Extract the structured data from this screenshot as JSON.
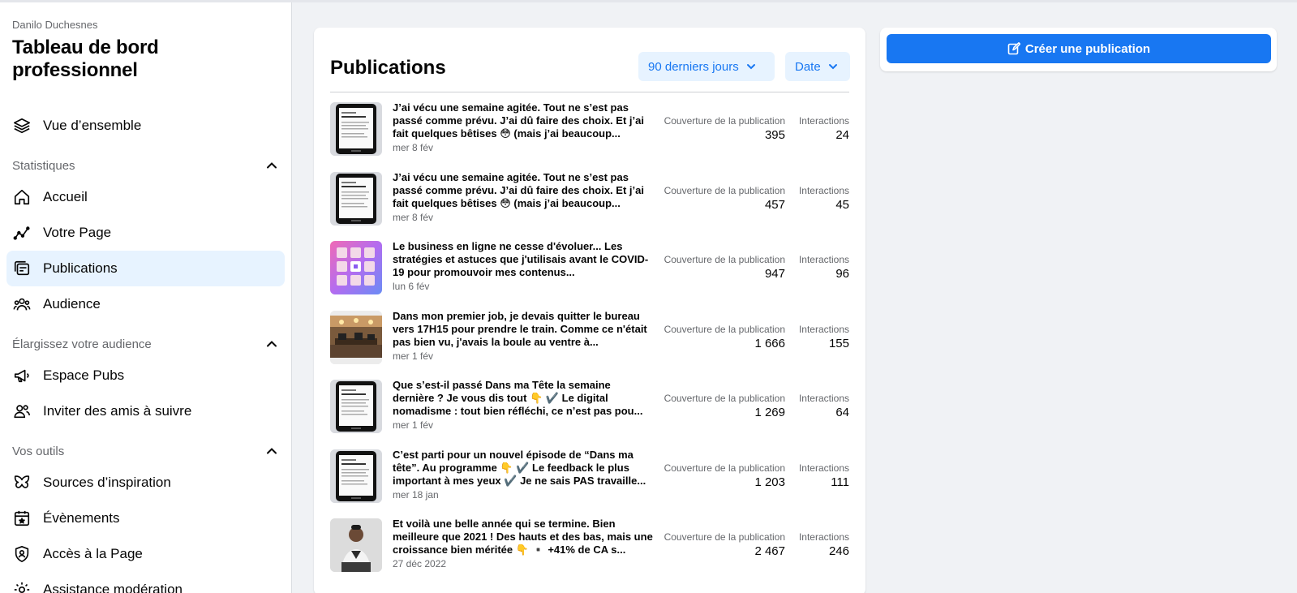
{
  "sidebar": {
    "owner": "Danilo Duchesnes",
    "title": "Tableau de bord professionnel",
    "overview": "Vue d’ensemble",
    "sections": [
      {
        "label": "Statistiques",
        "items": [
          "Accueil",
          "Votre Page",
          "Publications",
          "Audience"
        ]
      },
      {
        "label": "Élargissez votre audience",
        "items": [
          "Espace Pubs",
          "Inviter des amis à suivre"
        ]
      },
      {
        "label": "Vos outils",
        "items": [
          "Sources d’inspiration",
          "Évènements",
          "Accès à la Page",
          "Assistance modération"
        ]
      }
    ],
    "active_item": "Publications"
  },
  "card": {
    "title": "Publications",
    "range_filter": "90 derniers jours",
    "sort_filter": "Date",
    "reach_label": "Couverture de la publication",
    "interactions_label": "Interactions"
  },
  "posts": [
    {
      "text": "J’ai vécu une semaine agitée. Tout ne s’est pas passé comme prévu. J’ai dû faire des choix. Et j’ai fait quelques bêtises 😳 (mais j’ai beaucoup...",
      "date": "mer 8 fév",
      "reach": "395",
      "interactions": "24",
      "thumb": "phone-dark"
    },
    {
      "text": "J’ai vécu une semaine agitée. Tout ne s’est pas passé comme prévu. J’ai dû faire des choix. Et j’ai fait quelques bêtises 😳 (mais j’ai beaucoup...",
      "date": "mer 8 fév",
      "reach": "457",
      "interactions": "45",
      "thumb": "phone-dark"
    },
    {
      "text": "Le business en ligne ne cesse d'évoluer... Les stratégies et astuces que j'utilisais avant le COVID-19 pour promouvoir mes contenus...",
      "date": "lun 6 fév",
      "reach": "947",
      "interactions": "96",
      "thumb": "grid-pink"
    },
    {
      "text": "Dans mon premier job, je devais quitter le bureau vers 17H15 pour prendre le train. Comme ce n'était pas bien vu, j'avais la boule au ventre à...",
      "date": "mer 1 fév",
      "reach": "1 666",
      "interactions": "155",
      "thumb": "office-photo"
    },
    {
      "text": "Que s’est-il passé Dans ma Tête la semaine dernière ? Je vous dis tout 👇 ✔️ Le digital nomadisme : tout bien réfléchi, ce n’est pas pou...",
      "date": "mer 1 fév",
      "reach": "1 269",
      "interactions": "64",
      "thumb": "phone-dark"
    },
    {
      "text": "C’est parti pour un nouvel épisode de “Dans ma tête”. Au programme 👇 ✔️ Le feedback le plus important à mes yeux ✔️ Je ne sais PAS travaille...",
      "date": "mer 18 jan",
      "reach": "1 203",
      "interactions": "111",
      "thumb": "phone-dark"
    },
    {
      "text": "Et voilà une belle année qui se termine. Bien meilleure que 2021 ! Des hauts et des bas, mais une croissance bien méritée 👇 ▪️ +41% de CA s...",
      "date": "27 déc 2022",
      "reach": "2 467",
      "interactions": "246",
      "thumb": "portrait-photo"
    }
  ],
  "right_panel": {
    "create_label": "Créer une publication"
  },
  "colors": {
    "accent": "#1877f2",
    "accent_light": "#e7f3ff",
    "background": "#f0f2f5",
    "muted_text": "#65676b"
  }
}
